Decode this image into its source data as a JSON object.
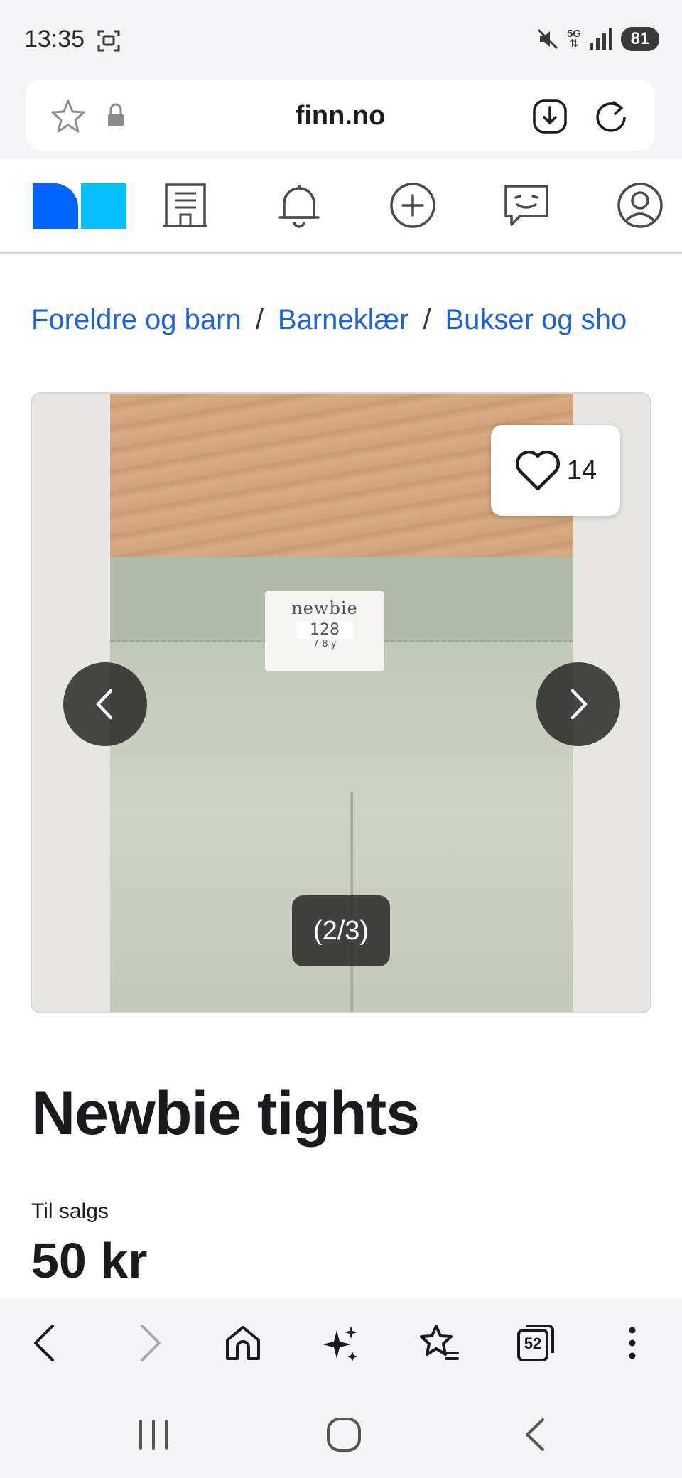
{
  "status_bar": {
    "time": "13:35",
    "network": "5G",
    "battery": "81",
    "icons": [
      "screenshot-icon",
      "mute-icon",
      "signal-icon",
      "battery-icon"
    ]
  },
  "browser": {
    "url": "finn.no",
    "icons": [
      "star-icon",
      "lock-icon",
      "download-icon",
      "reload-icon"
    ]
  },
  "finn_nav": {
    "icons": [
      "finn-logo",
      "building-icon",
      "bell-icon",
      "plus-circle-icon",
      "chat-icon",
      "profile-icon"
    ],
    "brand_colors": {
      "dark_blue": "#0063fb",
      "light_blue": "#06befb"
    }
  },
  "breadcrumb": {
    "items": [
      "Foreldre og barn",
      "Barneklær",
      "Bukser og sho"
    ],
    "separator": "/"
  },
  "gallery": {
    "favorites_count": "14",
    "counter": "(2/3)",
    "photo_label": {
      "brand": "newbie",
      "size": "128",
      "age": "7-8 y"
    }
  },
  "listing": {
    "title": "Newbie tights",
    "sale_label": "Til salgs",
    "price": "50 kr"
  },
  "browser_toolbar": {
    "tab_count": "52",
    "icons": [
      "back-icon",
      "forward-icon",
      "home-icon",
      "sparkle-icon",
      "bookmarks-icon",
      "tabs-icon",
      "more-icon"
    ]
  },
  "system_nav": {
    "icons": [
      "recents-icon",
      "home-button-icon",
      "system-back-icon"
    ]
  },
  "colors": {
    "link": "#1c62d6",
    "text": "#1b1b1f",
    "chrome": "#f4f4f6"
  }
}
